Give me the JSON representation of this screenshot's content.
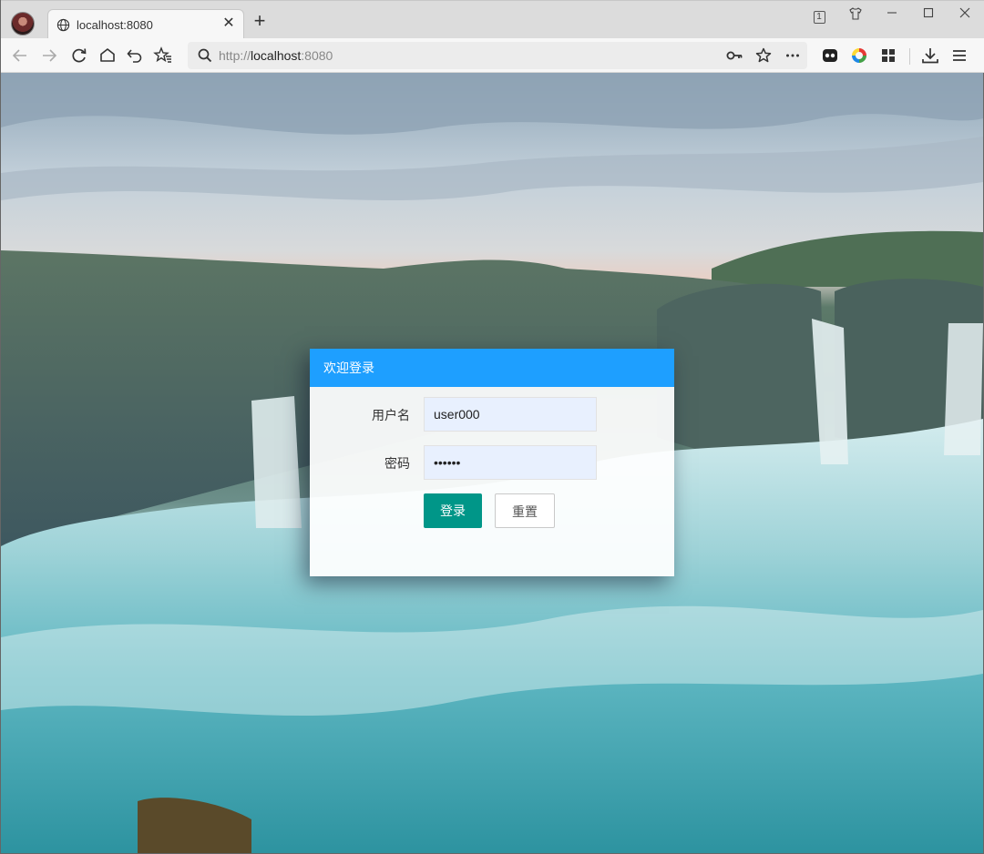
{
  "browser": {
    "tab_title": "localhost:8080",
    "new_tab_label": "+",
    "tab_count_badge": "1",
    "url_scheme": "http://",
    "url_host": "localhost",
    "url_port": ":8080",
    "window_controls": [
      "minimize",
      "maximize",
      "close"
    ]
  },
  "toolbar_icons": [
    "back-icon",
    "forward-icon",
    "reload-icon",
    "home-icon",
    "undo-icon",
    "favorites-icon",
    "search-icon",
    "key-icon",
    "star-icon",
    "more-icon",
    "extension-icon",
    "color-wheel-icon",
    "apps-icon",
    "download-icon",
    "menu-icon"
  ],
  "login": {
    "title": "欢迎登录",
    "username_label": "用户名",
    "username_value": "user000",
    "password_label": "密码",
    "password_value": "••••••",
    "login_button": "登录",
    "reset_button": "重置"
  },
  "colors": {
    "header_blue": "#1e9fff",
    "login_green": "#009688",
    "input_bg": "#e8f0fe"
  }
}
